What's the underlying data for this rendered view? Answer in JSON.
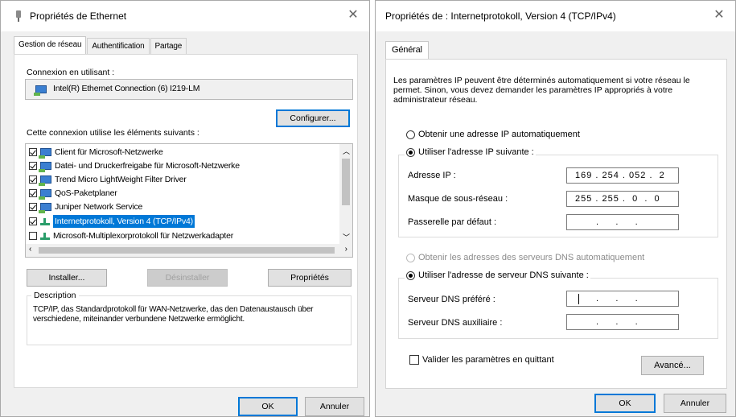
{
  "left": {
    "title": "Propriétés de Ethernet",
    "tabs": [
      "Gestion de réseau",
      "Authentification",
      "Partage"
    ],
    "connect_label": "Connexion en utilisant :",
    "adapter": "Intel(R) Ethernet Connection (6) I219-LM",
    "configure_btn": "Configurer...",
    "items_label": "Cette connexion utilise les éléments suivants :",
    "items": [
      {
        "label": "Client für Microsoft-Netzwerke",
        "checked": true,
        "icon": "network-icon"
      },
      {
        "label": "Datei- und Druckerfreigabe für Microsoft-Netzwerke",
        "checked": true,
        "icon": "network-icon"
      },
      {
        "label": "Trend Micro LightWeight Filter Driver",
        "checked": true,
        "icon": "network-icon"
      },
      {
        "label": "QoS-Paketplaner",
        "checked": true,
        "icon": "network-icon"
      },
      {
        "label": "Juniper Network Service",
        "checked": true,
        "icon": "network-icon"
      },
      {
        "label": "Internetprotokoll, Version 4 (TCP/IPv4)",
        "checked": true,
        "icon": "protocol-icon",
        "selected": true
      },
      {
        "label": "Microsoft-Multiplexorprotokoll für Netzwerkadapter",
        "checked": false,
        "icon": "protocol-icon"
      }
    ],
    "install_btn": "Installer...",
    "uninstall_btn": "Désinstaller",
    "properties_btn": "Propriétés",
    "description_label": "Description",
    "description_text": "TCP/IP, das Standardprotokoll für WAN-Netzwerke, das den Datenaustausch über verschiedene, miteinander verbundene Netzwerke ermöglicht.",
    "ok_btn": "OK",
    "cancel_btn": "Annuler"
  },
  "right": {
    "title": "Propriétés de : Internetprotokoll, Version 4 (TCP/IPv4)",
    "tab": "Général",
    "intro": "Les paramètres IP peuvent être déterminés automatiquement si votre réseau le permet. Sinon, vous devez demander les paramètres IP appropriés à votre administrateur réseau.",
    "auto_ip": "Obtenir une adresse IP automatiquement",
    "manual_ip": "Utiliser l'adresse IP suivante :",
    "ip_label": "Adresse IP :",
    "ip_value": "169 . 254 . 052 .  2",
    "mask_label": "Masque de sous-réseau :",
    "mask_value": "255 . 255 .  0  .  0",
    "gateway_label": "Passerelle par défaut :",
    "gateway_value": ".     .     .",
    "auto_dns": "Obtenir les adresses des serveurs DNS automatiquement",
    "manual_dns": "Utiliser l'adresse de serveur DNS suivante :",
    "dns_pref_label": "Serveur DNS préféré :",
    "dns_pref_value": ".     .     .",
    "dns_alt_label": "Serveur DNS auxiliaire :",
    "dns_alt_value": ".     .     .",
    "validate": "Valider les paramètres en quittant",
    "advanced_btn": "Avancé...",
    "ok_btn": "OK",
    "cancel_btn": "Annuler"
  }
}
